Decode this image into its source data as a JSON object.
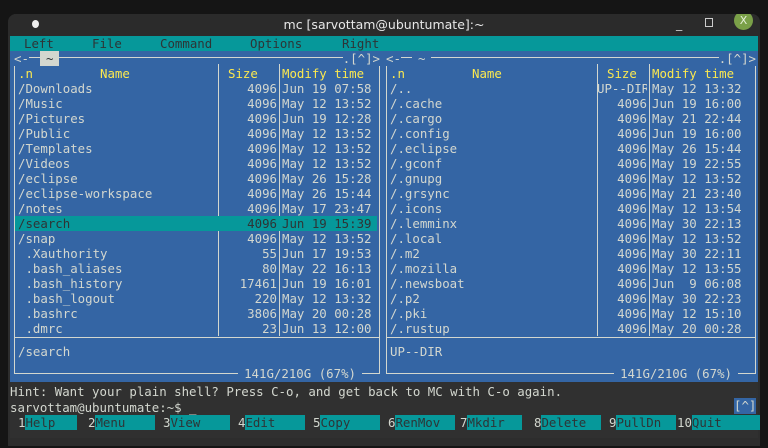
{
  "window": {
    "title": "mc [sarvottam@ubuntumate]:~",
    "minimize": "_",
    "close": "X"
  },
  "menu": [
    "Left",
    "File",
    "Command",
    "Options",
    "Right"
  ],
  "left": {
    "path": "~",
    "title_left": "<-",
    "title_right": ".[^]>",
    "headers": {
      "n": ".n",
      "name": "Name",
      "size": "Size",
      "time": "Modify time"
    },
    "selected": 9,
    "rows": [
      [
        "/Downloads",
        "4096",
        "Jun 19 07:58"
      ],
      [
        "/Music",
        "4096",
        "May 12 13:52"
      ],
      [
        "/Pictures",
        "4096",
        "Jun 19 12:28"
      ],
      [
        "/Public",
        "4096",
        "May 12 13:52"
      ],
      [
        "/Templates",
        "4096",
        "May 12 13:52"
      ],
      [
        "/Videos",
        "4096",
        "May 12 13:52"
      ],
      [
        "/eclipse",
        "4096",
        "May 26 15:28"
      ],
      [
        "/eclipse-workspace",
        "4096",
        "May 26 15:44"
      ],
      [
        "/notes",
        "4096",
        "May 17 23:47"
      ],
      [
        "/search",
        "4096",
        "Jun 19 15:39"
      ],
      [
        "/snap",
        "4096",
        "May 12 13:52"
      ],
      [
        " .Xauthority",
        "55",
        "Jun 17 19:53"
      ],
      [
        " .bash_aliases",
        "80",
        "May 22 16:13"
      ],
      [
        " .bash_history",
        "17461",
        "Jun 19 16:01"
      ],
      [
        " .bash_logout",
        "220",
        "May 12 13:32"
      ],
      [
        " .bashrc",
        "3806",
        "May 20 00:28"
      ],
      [
        " .dmrc",
        "23",
        "Jun 13 12:00"
      ]
    ],
    "status": "/search",
    "disk": "141G/210G (67%)"
  },
  "right": {
    "path": "~",
    "title_left": "<-",
    "title_right": ".[^]>",
    "headers": {
      "n": ".n",
      "name": "Name",
      "size": "Size",
      "time": "Modify time"
    },
    "selected": -1,
    "rows": [
      [
        "/..",
        "UP--DIR",
        "May 12 13:32"
      ],
      [
        "/.cache",
        "4096",
        "Jun 19 16:00"
      ],
      [
        "/.cargo",
        "4096",
        "May 21 22:44"
      ],
      [
        "/.config",
        "4096",
        "Jun 19 16:00"
      ],
      [
        "/.eclipse",
        "4096",
        "May 26 15:44"
      ],
      [
        "/.gconf",
        "4096",
        "May 19 22:55"
      ],
      [
        "/.gnupg",
        "4096",
        "May 12 13:52"
      ],
      [
        "/.grsync",
        "4096",
        "May 21 23:40"
      ],
      [
        "/.icons",
        "4096",
        "May 12 13:54"
      ],
      [
        "/.lemminx",
        "4096",
        "May 30 22:13"
      ],
      [
        "/.local",
        "4096",
        "May 12 13:52"
      ],
      [
        "/.m2",
        "4096",
        "May 30 22:11"
      ],
      [
        "/.mozilla",
        "4096",
        "May 12 13:55"
      ],
      [
        "/.newsboat",
        "4096",
        "Jun  9 06:08"
      ],
      [
        "/.p2",
        "4096",
        "May 30 22:23"
      ],
      [
        "/.pki",
        "4096",
        "May 12 15:10"
      ],
      [
        "/.rustup",
        "4096",
        "May 20 00:28"
      ]
    ],
    "status": "UP--DIR",
    "disk": "141G/210G (67%)"
  },
  "hint": "Hint: Want your plain shell? Press C-o, and get back to MC with C-o again.",
  "prompt": "sarvottam@ubuntumate:~$ _",
  "caret_btn": "[^]",
  "fkeys": [
    [
      "1",
      "Help"
    ],
    [
      "2",
      "Menu"
    ],
    [
      "3",
      "View"
    ],
    [
      "4",
      "Edit"
    ],
    [
      "5",
      "Copy"
    ],
    [
      "6",
      "RenMov"
    ],
    [
      "7",
      "Mkdir"
    ],
    [
      "8",
      "Delete"
    ],
    [
      "9",
      "PullDn"
    ],
    [
      "10",
      "Quit"
    ]
  ],
  "colors": {
    "panel": "#3465a4",
    "accent": "#06989a",
    "header": "#fce94f",
    "bg": "#303030"
  }
}
